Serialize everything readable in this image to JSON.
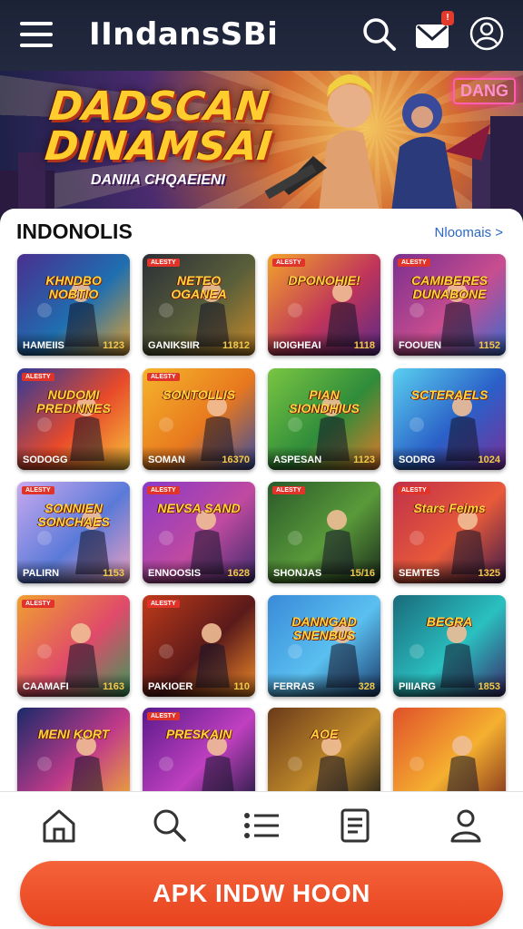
{
  "header": {
    "title": "IIndansSBi",
    "icons": [
      "menu-icon",
      "search-icon",
      "mail-icon",
      "account-icon"
    ]
  },
  "banner": {
    "title_line1": "DADSCAN",
    "title_line2": "DINAMSAI",
    "subtitle": "DANIIA CHQAEIENI",
    "neon_sign": "DANG"
  },
  "section": {
    "title": "INDONOLIS",
    "see_more": "Nloomais >"
  },
  "colors": {
    "accent": "#e8431e",
    "link": "#2b67c6",
    "header_bg": "#1c2236"
  },
  "games": [
    {
      "art_title": "KHNDBO NOBTIO",
      "name": "HAMEIIS",
      "number": "1123",
      "bg": [
        "#4a2f8f",
        "#1f6fb0",
        "#e0a030"
      ],
      "tag": ""
    },
    {
      "art_title": "NETEO OGANEA",
      "name": "GANIKSIIR",
      "number": "11812",
      "bg": [
        "#2b2f38",
        "#5a5f3a",
        "#c98a2a"
      ],
      "tag": "ALESTY"
    },
    {
      "art_title": "DPONOHIE!",
      "name": "IIOIGHEAI",
      "number": "1118",
      "bg": [
        "#f2a32b",
        "#c0355a",
        "#5b2a88"
      ],
      "tag": "ALESTY"
    },
    {
      "art_title": "CAMIBERES DUNABONE",
      "name": "FOOUEN",
      "number": "1152",
      "bg": [
        "#7a2f8f",
        "#c84d8f",
        "#3b6ad0"
      ],
      "tag": "ALESTY"
    },
    {
      "art_title": "NUDOMI PREDINNES",
      "name": "SODOGG",
      "number": "",
      "bg": [
        "#2e3a9a",
        "#e84a2a",
        "#f7c33a"
      ],
      "tag": "ALESTY"
    },
    {
      "art_title": "SONTOLLIS",
      "name": "SOMAN",
      "number": "16370",
      "bg": [
        "#f5b52c",
        "#e8781e",
        "#3a4ea0"
      ],
      "tag": "ALESTY"
    },
    {
      "art_title": "PIAN SIONDHIUS",
      "name": "ASPESAN",
      "number": "1123",
      "bg": [
        "#7ac642",
        "#2f8c3a",
        "#e07a2a"
      ],
      "tag": ""
    },
    {
      "art_title": "SCTERAELS",
      "name": "SODRG",
      "number": "1024",
      "bg": [
        "#5ad0f0",
        "#2a60c8",
        "#7a2f9a"
      ],
      "tag": ""
    },
    {
      "art_title": "SONNIEN SONCHAES",
      "name": "PALIRN",
      "number": "1153",
      "bg": [
        "#c9a9f0",
        "#5a7ad8",
        "#f0a0c0"
      ],
      "tag": "ALESTY"
    },
    {
      "art_title": "NEVSA SAND",
      "name": "ENNOOSIS",
      "number": "1628",
      "bg": [
        "#8a3ac8",
        "#c04aa0",
        "#3a2a6a"
      ],
      "tag": "ALESTY"
    },
    {
      "art_title": "",
      "name": "SHONJAS",
      "number": "15/16",
      "bg": [
        "#2a5a2a",
        "#5a9a3a",
        "#1a2a1a"
      ],
      "tag": "ALESTY"
    },
    {
      "art_title": "Stars Feims",
      "name": "SEMTES",
      "number": "1325",
      "bg": [
        "#c0304a",
        "#e85a3a",
        "#3a1a4a"
      ],
      "tag": "ALESTY"
    },
    {
      "art_title": "",
      "name": "CAAMAFI",
      "number": "1163",
      "bg": [
        "#f0a030",
        "#e04a6a",
        "#3a9a5a"
      ],
      "tag": "ALESTY"
    },
    {
      "art_title": "",
      "name": "PAKIOER",
      "number": "110",
      "bg": [
        "#c03a1a",
        "#5a1a1a",
        "#f08a2a"
      ],
      "tag": "ALESTY"
    },
    {
      "art_title": "DANNGAD SNENBUS",
      "name": "FERRAS",
      "number": "328",
      "bg": [
        "#3a8ad8",
        "#5ac0f0",
        "#1a3a6a"
      ],
      "tag": ""
    },
    {
      "art_title": "BEGRA",
      "name": "PIIIARG",
      "number": "1853",
      "bg": [
        "#1a6a7a",
        "#2ac0c0",
        "#3a2a6a"
      ],
      "tag": ""
    },
    {
      "art_title": "MENI KORT",
      "name": "",
      "number": "",
      "bg": [
        "#1a2a6a",
        "#c03a8a",
        "#f0b030"
      ],
      "tag": ""
    },
    {
      "art_title": "PRESKAIN",
      "name": "",
      "number": "",
      "bg": [
        "#5a1a8a",
        "#c040c0",
        "#1a1a3a"
      ],
      "tag": "ALESTY"
    },
    {
      "art_title": "AOE",
      "name": "",
      "number": "",
      "bg": [
        "#6a3a1a",
        "#c08a2a",
        "#1a1a1a"
      ],
      "tag": ""
    },
    {
      "art_title": "",
      "name": "",
      "number": "",
      "bg": [
        "#e0502a",
        "#f5b030",
        "#7a2a1a"
      ],
      "tag": ""
    }
  ],
  "bottom_nav": [
    "home-icon",
    "search-icon",
    "list-icon",
    "document-icon",
    "profile-icon"
  ],
  "cta": {
    "label": "APK INDW HOON"
  }
}
